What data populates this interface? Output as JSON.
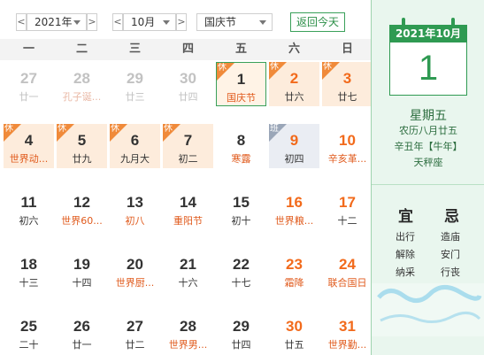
{
  "toolbar": {
    "prev_year": "<",
    "next_year": ">",
    "year_value": "2021年",
    "prev_month": "<",
    "next_month": ">",
    "month_value": "10月",
    "holiday_value": "国庆节",
    "today_label": "返回今天"
  },
  "weekdays": [
    "一",
    "二",
    "三",
    "四",
    "五",
    "六",
    "日"
  ],
  "rows": [
    [
      {
        "day": "27",
        "sub": "廿一",
        "faded": true
      },
      {
        "day": "28",
        "sub": "孔子诞...",
        "faded": true,
        "subFest": true
      },
      {
        "day": "29",
        "sub": "廿三",
        "faded": true
      },
      {
        "day": "30",
        "sub": "廿四",
        "faded": true
      },
      {
        "day": "1",
        "sub": "国庆节",
        "tag": "休",
        "selected": true,
        "subFest": true
      },
      {
        "day": "2",
        "sub": "廿六",
        "tag": "休",
        "holiday": true,
        "red": true
      },
      {
        "day": "3",
        "sub": "廿七",
        "tag": "休",
        "holiday": true,
        "red": true
      }
    ],
    [
      {
        "day": "4",
        "sub": "世界动...",
        "tag": "休",
        "holiday": true,
        "subFest": true
      },
      {
        "day": "5",
        "sub": "廿九",
        "tag": "休",
        "holiday": true
      },
      {
        "day": "6",
        "sub": "九月大",
        "tag": "休",
        "holiday": true
      },
      {
        "day": "7",
        "sub": "初二",
        "tag": "休",
        "holiday": true
      },
      {
        "day": "8",
        "sub": "寒露",
        "subFest": true
      },
      {
        "day": "9",
        "sub": "初四",
        "tag": "班",
        "workday": true,
        "red": true
      },
      {
        "day": "10",
        "sub": "辛亥革...",
        "red": true,
        "subFest": true
      }
    ],
    [
      {
        "day": "11",
        "sub": "初六"
      },
      {
        "day": "12",
        "sub": "世界60...",
        "subFest": true
      },
      {
        "day": "13",
        "sub": "初八",
        "subFest": true
      },
      {
        "day": "14",
        "sub": "重阳节",
        "subFest": true
      },
      {
        "day": "15",
        "sub": "初十"
      },
      {
        "day": "16",
        "sub": "世界粮...",
        "red": true,
        "subFest": true
      },
      {
        "day": "17",
        "sub": "十二",
        "red": true
      }
    ],
    [
      {
        "day": "18",
        "sub": "十三"
      },
      {
        "day": "19",
        "sub": "十四"
      },
      {
        "day": "20",
        "sub": "世界厨...",
        "subFest": true
      },
      {
        "day": "21",
        "sub": "十六"
      },
      {
        "day": "22",
        "sub": "十七"
      },
      {
        "day": "23",
        "sub": "霜降",
        "red": true,
        "subFest": true
      },
      {
        "day": "24",
        "sub": "联合国日",
        "red": true,
        "subFest": true
      }
    ],
    [
      {
        "day": "25",
        "sub": "二十"
      },
      {
        "day": "26",
        "sub": "廿一"
      },
      {
        "day": "27",
        "sub": "廿二"
      },
      {
        "day": "28",
        "sub": "世界男...",
        "subFest": true
      },
      {
        "day": "29",
        "sub": "廿四"
      },
      {
        "day": "30",
        "sub": "廿五",
        "red": true
      },
      {
        "day": "31",
        "sub": "世界勤...",
        "red": true,
        "subFest": true
      }
    ]
  ],
  "detail": {
    "pad_header": "2021年10月",
    "pad_day": "1",
    "weekday": "星期五",
    "lunar": "农历八月廿五",
    "ganzhi": "辛丑年【牛年】",
    "constellation": "天秤座",
    "yi_title": "宜",
    "ji_title": "忌",
    "yi_items": [
      "出行",
      "解除",
      "纳采"
    ],
    "ji_items": [
      "造庙",
      "安门",
      "行丧"
    ]
  },
  "colors": {
    "accent_green": "#2f9a52",
    "holiday_orange": "#f26a1b",
    "holiday_bg": "#fdecdc"
  }
}
